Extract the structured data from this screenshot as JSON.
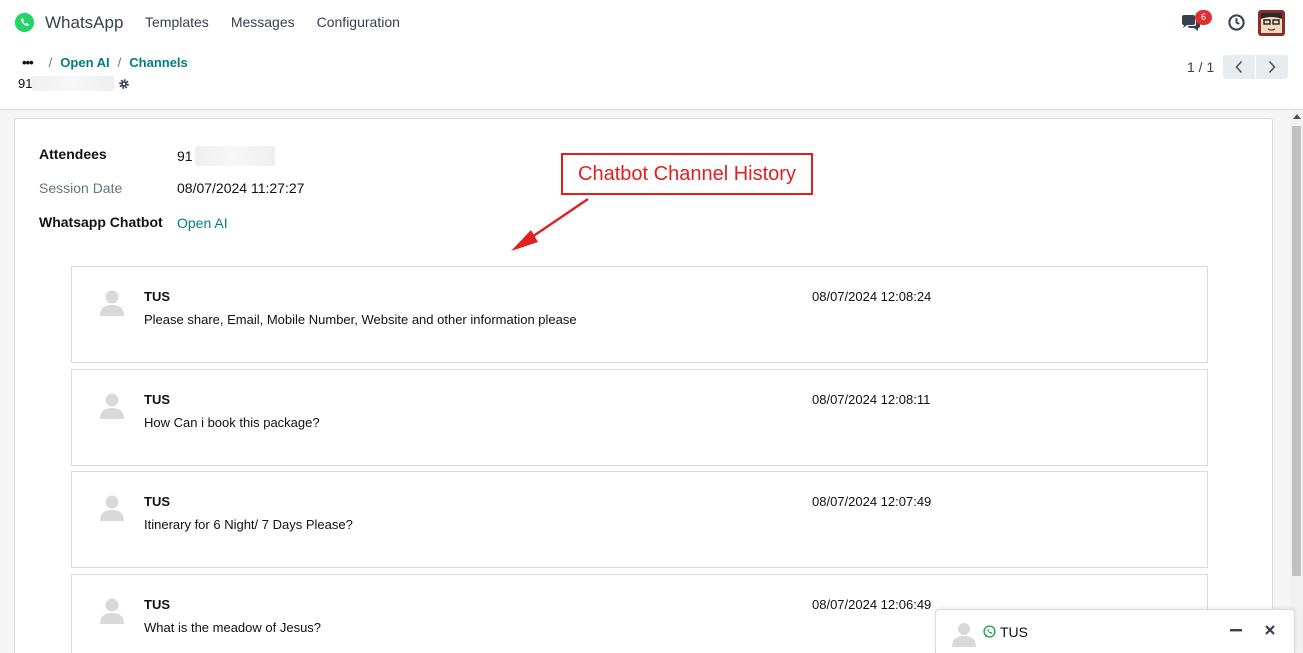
{
  "navbar": {
    "app_title": "WhatsApp",
    "menu": [
      "Templates",
      "Messages",
      "Configuration"
    ],
    "chat_badge": "6",
    "icons": {
      "logo": "whatsapp-icon",
      "chat": "chat-bubbles-icon",
      "activity": "clock-icon",
      "user": "avatar"
    }
  },
  "control_panel": {
    "breadcrumb": {
      "dots": "•••",
      "items": [
        "Open AI",
        "Channels"
      ]
    },
    "record_name": "91",
    "pager": "1 / 1"
  },
  "form": {
    "fields": [
      {
        "label": "Attendees",
        "value": "91"
      },
      {
        "label": "Session Date",
        "value": "08/07/2024 11:27:27"
      },
      {
        "label": "Whatsapp Chatbot",
        "value": "Open AI"
      }
    ]
  },
  "annotation": {
    "text": "Chatbot Channel History",
    "color": "#e02020"
  },
  "messages": [
    {
      "author": "TUS",
      "date": "08/07/2024 12:08:24",
      "body": "Please share, Email, Mobile Number, Website and other information please"
    },
    {
      "author": "TUS",
      "date": "08/07/2024 12:08:11",
      "body": "How Can i book this package?"
    },
    {
      "author": "TUS",
      "date": "08/07/2024 12:07:49",
      "body": "Itinerary for 6 Night/ 7 Days Please?"
    },
    {
      "author": "TUS",
      "date": "08/07/2024 12:06:49",
      "body": "What is the meadow of Jesus?"
    }
  ],
  "chat_window": {
    "name": "TUS"
  },
  "colors": {
    "accent": "#017e84",
    "badge": "#e03131",
    "whatsapp_green": "#25d366"
  }
}
